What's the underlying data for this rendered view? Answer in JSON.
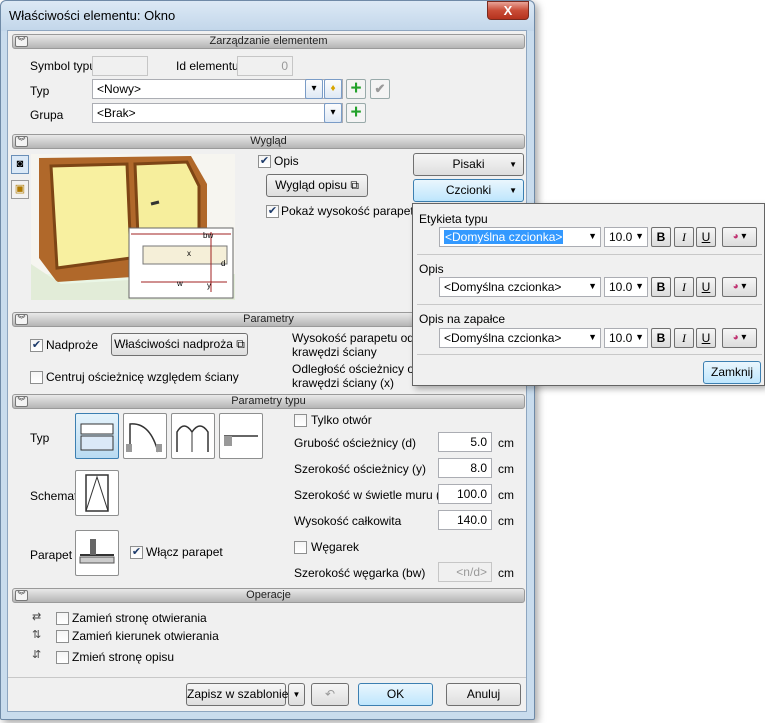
{
  "window": {
    "title": "Właściwości elementu: Okno",
    "close": "X"
  },
  "sections": {
    "management": "Zarządzanie elementem",
    "appearance": "Wygląd",
    "params": "Parametry",
    "type_params": "Parametry typu",
    "operations": "Operacje"
  },
  "management": {
    "symbol_label": "Symbol typu",
    "symbol_value": "",
    "id_label": "Id elementu",
    "id_value": "0",
    "type_label": "Typ",
    "type_value": "<Nowy>",
    "group_label": "Grupa",
    "group_value": "<Brak>"
  },
  "appearance": {
    "opis_label": "Opis",
    "opis_checked": true,
    "wyglad_opisu_button": "Wygląd opisu",
    "show_height_label": "Pokaż wysokość parapetu",
    "show_height_checked": true,
    "pisaki_button": "Pisaki",
    "czcionki_button": "Czcionki",
    "preview_labels": {
      "bw": "bw",
      "x": "x",
      "d": "d",
      "w": "w",
      "y": "y"
    }
  },
  "params": {
    "nadproze_label": "Nadproże",
    "nadproze_checked": true,
    "nadproze_button": "Właściwości nadproża",
    "center_label": "Centruj ościeżnicę względem ściany",
    "center_checked": false,
    "sill_height_label_1": "Wysokość parapetu od d",
    "sill_height_label_2": "krawędzi ściany",
    "frame_dist_label_1": "Odległość ościeżnicy od",
    "frame_dist_label_2": "krawędzi ściany (x)"
  },
  "type_params": {
    "typ_label": "Typ",
    "schemat_label": "Schemat",
    "parapet_label": "Parapet",
    "enable_parapet_label": "Włącz parapet",
    "enable_parapet_checked": true,
    "only_opening_label": "Tylko otwór",
    "only_opening_checked": false,
    "fields": [
      {
        "label": "Grubość ościeżnicy (d)",
        "value": "5.0",
        "unit": "cm"
      },
      {
        "label": "Szerokość ościeżnicy (y)",
        "value": "8.0",
        "unit": "cm"
      },
      {
        "label": "Szerokość w świetle muru (w)",
        "value": "100.0",
        "unit": "cm"
      },
      {
        "label": "Wysokość całkowita",
        "value": "140.0",
        "unit": "cm"
      }
    ],
    "wegarek_label": "Węgarek",
    "wegarek_checked": false,
    "wegarek_width_label": "Szerokość węgarka (bw)",
    "wegarek_width_value": "<n/d>",
    "wegarek_width_unit": "cm"
  },
  "operations": {
    "items": [
      {
        "label": "Zamień stronę otwierania"
      },
      {
        "label": "Zamień kierunek otwierania"
      },
      {
        "label": "Zmień stronę opisu"
      }
    ]
  },
  "footer": {
    "save_template": "Zapisz w szablonie",
    "ok": "OK",
    "cancel": "Anuluj"
  },
  "fonts_popup": {
    "groups": [
      {
        "title": "Etykieta typu",
        "font": "<Domyślna czcionka>",
        "size": "10.0"
      },
      {
        "title": "Opis",
        "font": "<Domyślna czcionka>",
        "size": "10.0"
      },
      {
        "title": "Opis na zapałce",
        "font": "<Domyślna czcionka>",
        "size": "10.0"
      }
    ],
    "bold": "B",
    "italic": "I",
    "underline": "U",
    "close_button": "Zamknij"
  }
}
